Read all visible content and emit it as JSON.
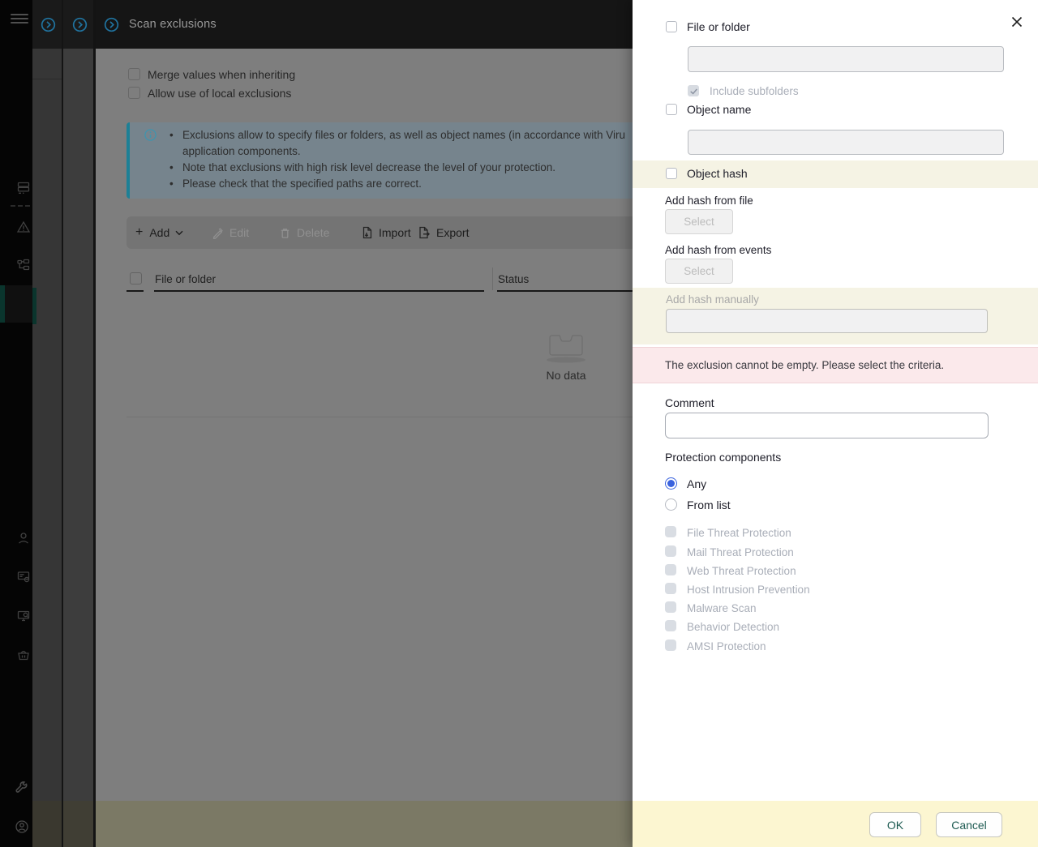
{
  "header": {
    "title": "Scan exclusions"
  },
  "main": {
    "checkboxes": [
      {
        "label": "Merge values when inheriting",
        "checked": false
      },
      {
        "label": "Allow use of local exclusions",
        "checked": false
      }
    ],
    "info": {
      "bullet1_line1": "Exclusions allow to specify files or folders, as well as object names (in accordance with Viru",
      "bullet1_line2": "application components.",
      "bullet2": "Note that exclusions with high risk level decrease the level of your protection.",
      "bullet3": "Please check that the specified paths are correct."
    },
    "toolbar": {
      "add": "Add",
      "edit": "Edit",
      "delete": "Delete",
      "import": "Import",
      "export": "Export"
    },
    "table": {
      "col_file": "File or folder",
      "col_status": "Status",
      "empty": "No data"
    }
  },
  "drawer": {
    "file_or_folder_label": "File or folder",
    "include_subfolders_label": "Include subfolders",
    "object_name_label": "Object name",
    "object_hash_label": "Object hash",
    "add_hash_from_file_label": "Add hash from file",
    "add_hash_from_events_label": "Add hash from events",
    "add_hash_manually_label": "Add hash manually",
    "select_button": "Select",
    "error_message": "The exclusion cannot be empty. Please select the criteria.",
    "comment_label": "Comment",
    "protection_components_label": "Protection components",
    "radio_any": "Any",
    "radio_from_list": "From list",
    "components": [
      "File Threat Protection",
      "Mail Threat Protection",
      "Web Threat Protection",
      "Host Intrusion Prevention",
      "Malware Scan",
      "Behavior Detection",
      "AMSI Protection"
    ],
    "values": {
      "file_or_folder": "",
      "object_name": "",
      "hash": "",
      "comment": ""
    },
    "ok_button": "OK",
    "cancel_button": "Cancel"
  },
  "icons": {
    "hamburger": "≡",
    "expand": "›",
    "info": "ⓘ",
    "add": "+",
    "dropdown": "⌄",
    "edit": "✎",
    "delete": "🗑",
    "import": "⤓",
    "export": "⤒",
    "close": "✕",
    "empty": "tray"
  },
  "colors": {
    "accent_teal": "#1d8096",
    "accent_blue": "#20739f",
    "radio_blue": "#3a63de",
    "cream_highlight": "#f5f3e4",
    "error_bg": "#fbe9eb",
    "footer_yellow": "#fcf6d1",
    "button_green": "#1d5a51",
    "dim_content": "#7e7e7e",
    "drawer_bg": "#ffffff"
  }
}
